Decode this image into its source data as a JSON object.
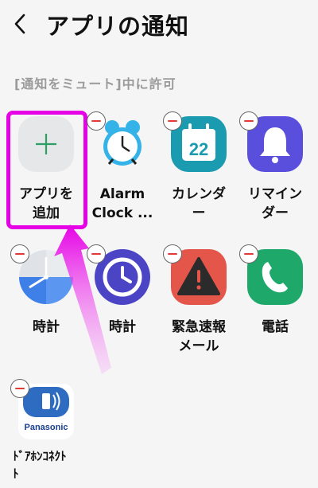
{
  "header": {
    "title": "アプリの通知",
    "back_icon": "chevron-left-icon"
  },
  "section_label": "[通知をミュート]中に許可",
  "add_app": {
    "label": "アプリを\n追加",
    "icon": "plus-icon"
  },
  "apps": [
    {
      "label": "Alarm\nClock ...",
      "icon": "alarm-clock-icon"
    },
    {
      "label": "カレンダ\nー",
      "icon": "calendar-icon",
      "day": "22"
    },
    {
      "label": "リマイン\nダー",
      "icon": "bell-icon"
    },
    {
      "label": "時計",
      "icon": "clock-icon"
    },
    {
      "label": "時計",
      "icon": "clock-icon"
    },
    {
      "label": "緊急速報\nメール",
      "icon": "warning-icon"
    },
    {
      "label": "電話",
      "icon": "phone-icon"
    },
    {
      "label": "ﾄﾞｱﾎﾝｺﾈｸﾄ\nﾄ",
      "icon": "panasonic-door-icon",
      "brand": "Panasonic"
    }
  ],
  "colors": {
    "highlight": "#e600e6",
    "minus": "#e23a36"
  }
}
